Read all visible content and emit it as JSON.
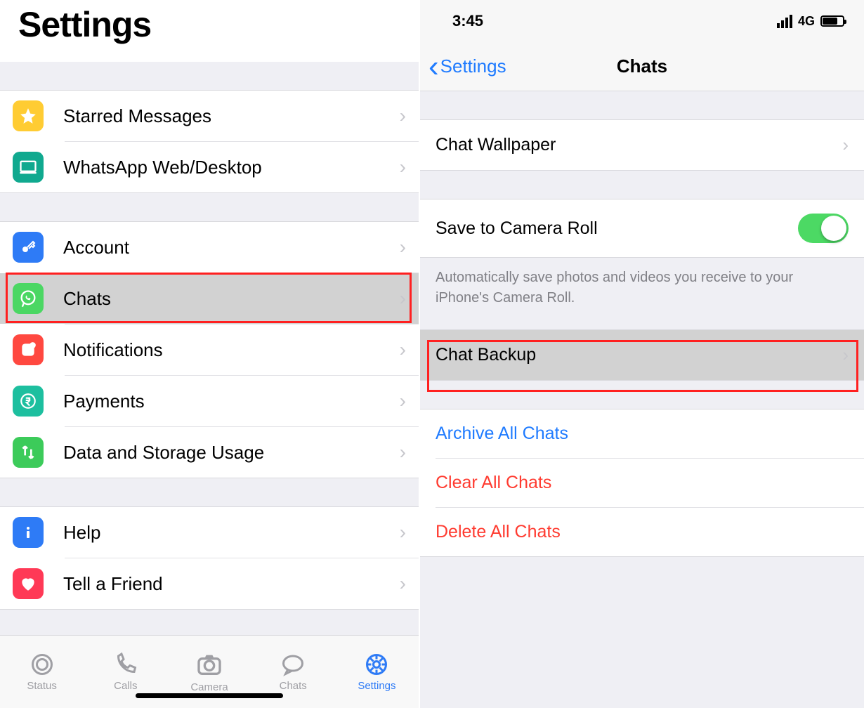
{
  "left": {
    "title": "Settings",
    "group1": [
      {
        "id": "starred",
        "label": "Starred Messages",
        "iconClass": "icon-star",
        "iconName": "star-icon"
      },
      {
        "id": "web",
        "label": "WhatsApp Web/Desktop",
        "iconClass": "icon-desktop",
        "iconName": "laptop-icon"
      }
    ],
    "group2": [
      {
        "id": "account",
        "label": "Account",
        "iconClass": "icon-key",
        "iconName": "key-icon"
      },
      {
        "id": "chats",
        "label": "Chats",
        "iconClass": "icon-chats",
        "iconName": "whatsapp-icon",
        "selected": true
      },
      {
        "id": "notifications",
        "label": "Notifications",
        "iconClass": "icon-bell",
        "iconName": "notification-icon"
      },
      {
        "id": "payments",
        "label": "Payments",
        "iconClass": "icon-rupee",
        "iconName": "rupee-icon"
      },
      {
        "id": "data",
        "label": "Data and Storage Usage",
        "iconClass": "icon-data",
        "iconName": "data-transfer-icon"
      }
    ],
    "group3": [
      {
        "id": "help",
        "label": "Help",
        "iconClass": "icon-info",
        "iconName": "info-icon"
      },
      {
        "id": "tell",
        "label": "Tell a Friend",
        "iconClass": "icon-heart",
        "iconName": "heart-icon"
      }
    ],
    "tabs": [
      {
        "id": "status",
        "label": "Status",
        "iconName": "status-tab-icon"
      },
      {
        "id": "calls",
        "label": "Calls",
        "iconName": "calls-tab-icon"
      },
      {
        "id": "camera",
        "label": "Camera",
        "iconName": "camera-tab-icon"
      },
      {
        "id": "chats",
        "label": "Chats",
        "iconName": "chats-tab-icon"
      },
      {
        "id": "settings",
        "label": "Settings",
        "iconName": "settings-tab-icon",
        "active": true
      }
    ]
  },
  "right": {
    "status_time": "3:45",
    "network_label": "4G",
    "back_label": "Settings",
    "nav_title": "Chats",
    "wallpaper_label": "Chat Wallpaper",
    "save_label": "Save to Camera Roll",
    "save_toggle_on": true,
    "save_desc": "Automatically save photos and videos you receive to your iPhone's Camera Roll.",
    "backup_label": "Chat Backup",
    "archive_label": "Archive All Chats",
    "clear_label": "Clear All Chats",
    "delete_label": "Delete All Chats"
  }
}
